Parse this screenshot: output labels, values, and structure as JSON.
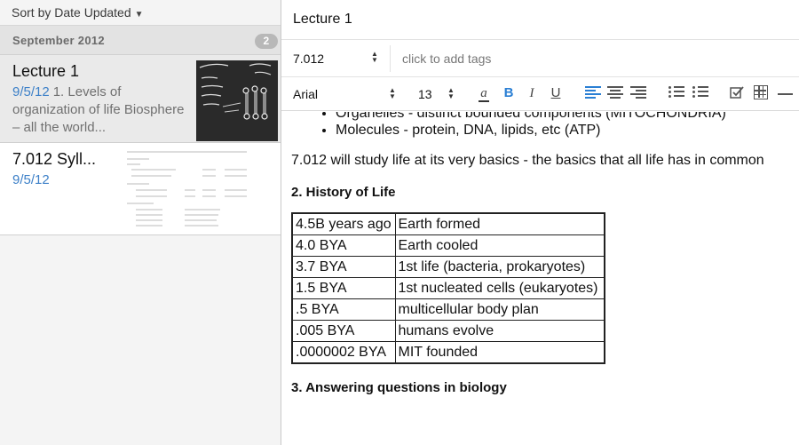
{
  "note_list": {
    "sort_label": "Sort by Date Updated",
    "group": {
      "label": "September 2012",
      "count": "2"
    },
    "notes": [
      {
        "title": "Lecture 1",
        "date": "9/5/12",
        "snippet": "1. Levels of organization of life Biosphere – all the world..."
      },
      {
        "title": "7.012 Syll...",
        "date": "9/5/12",
        "snippet": ""
      }
    ]
  },
  "editor": {
    "title": "Lecture 1",
    "notebook": "7.012",
    "tags_placeholder": "click to add tags",
    "toolbar": {
      "font": "Arial",
      "size": "13",
      "color_glyph": "a",
      "bold_glyph": "B",
      "italic_glyph": "I",
      "underline_glyph": "U"
    },
    "body": {
      "bullets": [
        "Organelles - distinct bounded components (MITOCHONDRIA)",
        "Molecules - protein, DNA, lipids, etc (ATP)"
      ],
      "summary": "7.012 will study life at its very basics - the basics that all life has in common",
      "section_history": "2. History of Life",
      "timeline": [
        {
          "time": "4.5B years ago",
          "event": "Earth formed"
        },
        {
          "time": "4.0 BYA",
          "event": "Earth cooled"
        },
        {
          "time": "3.7 BYA",
          "event": "1st life (bacteria, prokaryotes)"
        },
        {
          "time": "1.5 BYA",
          "event": "1st nucleated cells (eukaryotes)"
        },
        {
          "time": ".5 BYA",
          "event": "multicellular body plan"
        },
        {
          "time": ".005 BYA",
          "event": "humans evolve"
        },
        {
          "time": ".0000002 BYA",
          "event": "MIT founded"
        }
      ],
      "section_questions": "3. Answering questions in biology"
    }
  },
  "colors": {
    "accent_blue": "#2a7fd4",
    "date_blue": "#3d80c8",
    "sidebar_bg": "#f4f4f4",
    "selected_bg": "#eaeaea"
  }
}
